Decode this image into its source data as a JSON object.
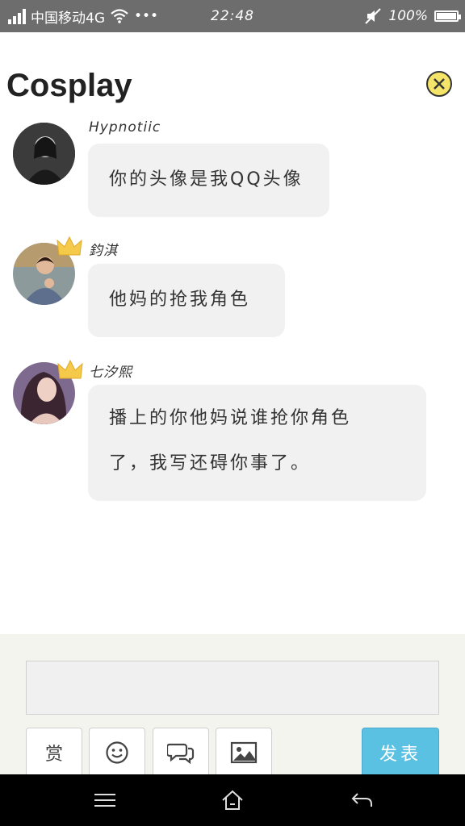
{
  "status_bar": {
    "carrier": "中国移动4G",
    "time": "22:48",
    "battery": "100%",
    "more": "•••"
  },
  "header": {
    "title": "Cosplay"
  },
  "messages": [
    {
      "username": "Hypnotiic",
      "text": "你的头像是我QQ头像",
      "avatar_color": "#3a3a3a",
      "crown": false
    },
    {
      "username": "鈞淇",
      "text": "他妈的抢我角色",
      "avatar_color": "#7a8fa0",
      "crown": true
    },
    {
      "username": "七汐熙",
      "text_line1": "播上的你他妈说谁抢你角色",
      "text_line2": "了，我写还碍你事了。",
      "avatar_color": "#8a6c86",
      "crown": true
    }
  ],
  "composer": {
    "reward_label": "赏",
    "send_label": "发表"
  },
  "colors": {
    "accent_send": "#5bc1e3",
    "close_button": "#f4e56a",
    "bubble": "#f1f1f1"
  }
}
